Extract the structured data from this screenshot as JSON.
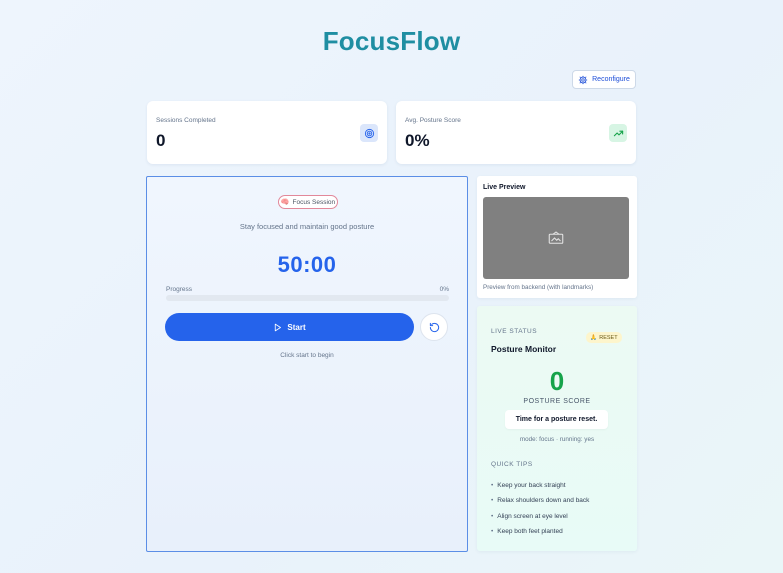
{
  "app": {
    "title": "FocusFlow"
  },
  "toolbar": {
    "reconfigure_label": "Reconfigure",
    "reconfigure_icon": "gear-icon"
  },
  "stats": {
    "sessions": {
      "label": "Sessions Completed",
      "value": "0",
      "icon": "target-icon"
    },
    "posture": {
      "label": "Avg. Posture Score",
      "value": "0%",
      "icon": "trending-up-icon"
    }
  },
  "focus": {
    "badge_icon": "🧠",
    "badge_label": "Focus Session",
    "subtitle": "Stay focused and maintain good posture",
    "timer": "50:00",
    "progress_label": "Progress",
    "progress_pct": "0%",
    "progress_fraction": 0,
    "start_label": "Start",
    "hint": "Click start to begin"
  },
  "preview": {
    "title": "Live Preview",
    "caption": "Preview from backend (with landmarks)",
    "frame_color": "#808080"
  },
  "status": {
    "section_label": "LIVE STATUS",
    "badge_icon": "🙏",
    "badge_label": "RESET",
    "title": "Posture Monitor",
    "score": "0",
    "score_label": "POSTURE SCORE",
    "message": "Time for a posture reset.",
    "mode_line": "mode: focus · running: yes",
    "tips_title": "QUICK TIPS",
    "tips": [
      "Keep your back straight",
      "Relax shoulders down and back",
      "Align screen at eye level",
      "Keep both feet planted"
    ]
  },
  "colors": {
    "brand": "#1f8ea2",
    "primary": "#2563eb",
    "score": "#16a34a"
  }
}
